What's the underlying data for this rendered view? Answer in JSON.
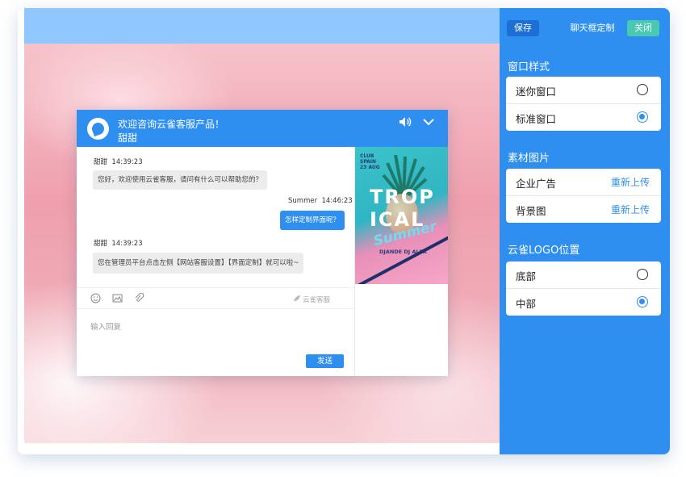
{
  "settings": {
    "save_label": "保存",
    "title": "聊天框定制",
    "close_label": "关闭",
    "window_style": {
      "title": "窗口样式",
      "options": [
        {
          "label": "迷你窗口",
          "selected": false
        },
        {
          "label": "标准窗口",
          "selected": true
        }
      ]
    },
    "material": {
      "title": "素材图片",
      "items": [
        {
          "label": "企业广告",
          "action": "重新上传"
        },
        {
          "label": "背景图",
          "action": "重新上传"
        }
      ]
    },
    "logo_position": {
      "title": "云雀LOGO位置",
      "options": [
        {
          "label": "底部",
          "selected": false
        },
        {
          "label": "中部",
          "selected": true
        }
      ]
    }
  },
  "chat": {
    "title": "欢迎咨询云雀客服产品！",
    "agent_name": "甜甜",
    "messages": [
      {
        "sender": "甜甜",
        "time": "14:39:23",
        "text": "您好，欢迎使用云雀客服，请问有什么可以帮助您的？",
        "direction": "in"
      },
      {
        "sender": "Summer",
        "time": "14:46:23",
        "text": "怎样定制界面呢？",
        "direction": "out"
      },
      {
        "sender": "甜甜",
        "time": "14:39:23",
        "text": "您在管理员平台点击左侧【网站客服设置】【界面定制】就可以啦~",
        "direction": "in"
      }
    ],
    "brand": "云雀客服",
    "reply_placeholder": "输入回复",
    "send_label": "发送"
  },
  "ad": {
    "club_text": "CLUB SPAIN 23 AUG",
    "title_line1": "TROP",
    "title_line2": "ICAL",
    "script": "Summer",
    "dj": "DJANDE DJ ALEX"
  },
  "colors": {
    "accent": "#2f8ff0",
    "close_button": "#48c9b0",
    "topbar": "#8ec8ff"
  }
}
